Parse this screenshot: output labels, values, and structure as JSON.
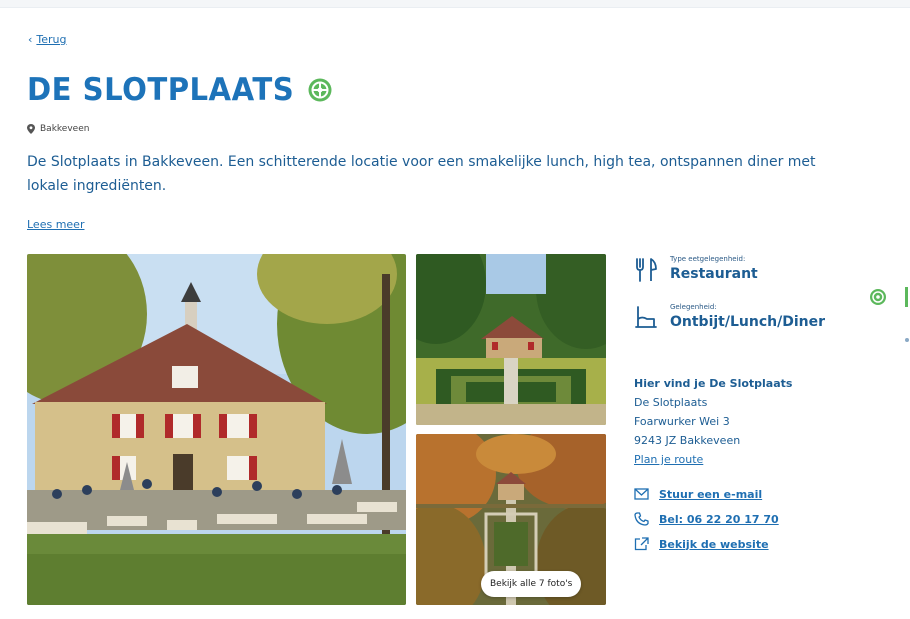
{
  "nav": {
    "back_label": "Terug"
  },
  "venue": {
    "title": "DE SLOTPLAATS",
    "location": "Bakkeveen",
    "intro": "De Slotplaats in Bakkeveen. Een schitterende locatie voor een smakelijke lunch, high tea, ontspannen diner met lokale ingrediënten.",
    "read_more": "Lees meer"
  },
  "gallery": {
    "all_photos_label": "Bekijk alle 7 foto's"
  },
  "details": {
    "type_label": "Type eetgelegenheid:",
    "type_value": "Restaurant",
    "occasion_label": "Gelegenheid:",
    "occasion_value": "Ontbijt/Lunch/Diner"
  },
  "address": {
    "heading": "Hier vind je De Slotplaats",
    "name": "De Slotplaats",
    "street": "Foarwurker Wei 3",
    "postal_city": "9243 JZ Bakkeveen",
    "route_link": "Plan je route"
  },
  "contact": {
    "email": "Stuur een e-mail",
    "phone": "Bel: 06 22 20 17 70",
    "website": "Bekijk de website"
  },
  "colors": {
    "brand_blue": "#1d73b9",
    "text_blue": "#1d5d93",
    "badge_green": "#5cb85c"
  },
  "icons": [
    "chevron-left-icon",
    "sustainability-badge-icon",
    "map-pin-icon",
    "fork-knife-icon",
    "chair-icon",
    "mail-icon",
    "phone-icon",
    "external-link-icon"
  ]
}
